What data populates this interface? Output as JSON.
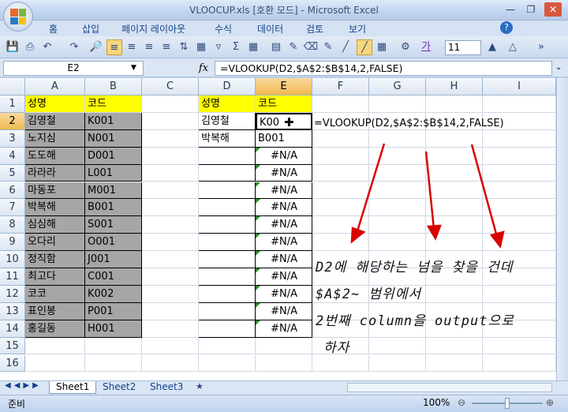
{
  "window": {
    "title": "VLOOCUP.xls  [호환 모드] - Microsoft Excel"
  },
  "menu": [
    "홈",
    "삽입",
    "페이지 레이아웃",
    "수식",
    "데이터",
    "검토",
    "보기"
  ],
  "toolbar": {
    "font_size": "11"
  },
  "formula_bar": {
    "name_box": "E2",
    "fx": "fx",
    "formula": "=VLOOKUP(D2,$A$2:$B$14,2,FALSE)"
  },
  "columns": [
    "A",
    "B",
    "C",
    "D",
    "E",
    "F",
    "G",
    "H",
    "I"
  ],
  "rows": [
    "1",
    "2",
    "3",
    "4",
    "5",
    "6",
    "7",
    "8",
    "9",
    "10",
    "11",
    "12",
    "13",
    "14",
    "15",
    "16"
  ],
  "table_a": {
    "header_name": "성명",
    "header_code": "코드",
    "rows": [
      {
        "name": "김영철",
        "code": "K001"
      },
      {
        "name": "노지심",
        "code": "N001"
      },
      {
        "name": "도도해",
        "code": "D001"
      },
      {
        "name": "라라라",
        "code": "L001"
      },
      {
        "name": "마동포",
        "code": "M001"
      },
      {
        "name": "박복해",
        "code": "B001"
      },
      {
        "name": "심심해",
        "code": "S001"
      },
      {
        "name": "오다리",
        "code": "O001"
      },
      {
        "name": "정직함",
        "code": "J001"
      },
      {
        "name": "최고다",
        "code": "C001"
      },
      {
        "name": "코코",
        "code": "K002"
      },
      {
        "name": "표인봉",
        "code": "P001"
      },
      {
        "name": "홍길동",
        "code": "H001"
      }
    ]
  },
  "table_d": {
    "header_name": "성명",
    "header_code": "코드",
    "rows": [
      {
        "name": "김영철",
        "code": "K00"
      },
      {
        "name": "박복해",
        "code": "B001"
      },
      {
        "name": "",
        "code": "#N/A"
      },
      {
        "name": "",
        "code": "#N/A"
      },
      {
        "name": "",
        "code": "#N/A"
      },
      {
        "name": "",
        "code": "#N/A"
      },
      {
        "name": "",
        "code": "#N/A"
      },
      {
        "name": "",
        "code": "#N/A"
      },
      {
        "name": "",
        "code": "#N/A"
      },
      {
        "name": "",
        "code": "#N/A"
      },
      {
        "name": "",
        "code": "#N/A"
      },
      {
        "name": "",
        "code": "#N/A"
      },
      {
        "name": "",
        "code": "#N/A"
      }
    ]
  },
  "annotation": {
    "formula_text": "=VLOOKUP(D2,$A$2:$B$14,2,FALSE)",
    "line1": "D2에 해당하는 넘을 찾을 건데",
    "line2": "$A$2~ 범위에서",
    "line3": "2번째 column을 output으로",
    "line4": "하자"
  },
  "sheets": [
    "Sheet1",
    "Sheet2",
    "Sheet3"
  ],
  "status": {
    "ready": "준비",
    "zoom": "100%"
  },
  "colors": {
    "header_yellow": "#ffff00",
    "lookup_gray": "#a6a6a6",
    "selection": "#f1b94f"
  }
}
